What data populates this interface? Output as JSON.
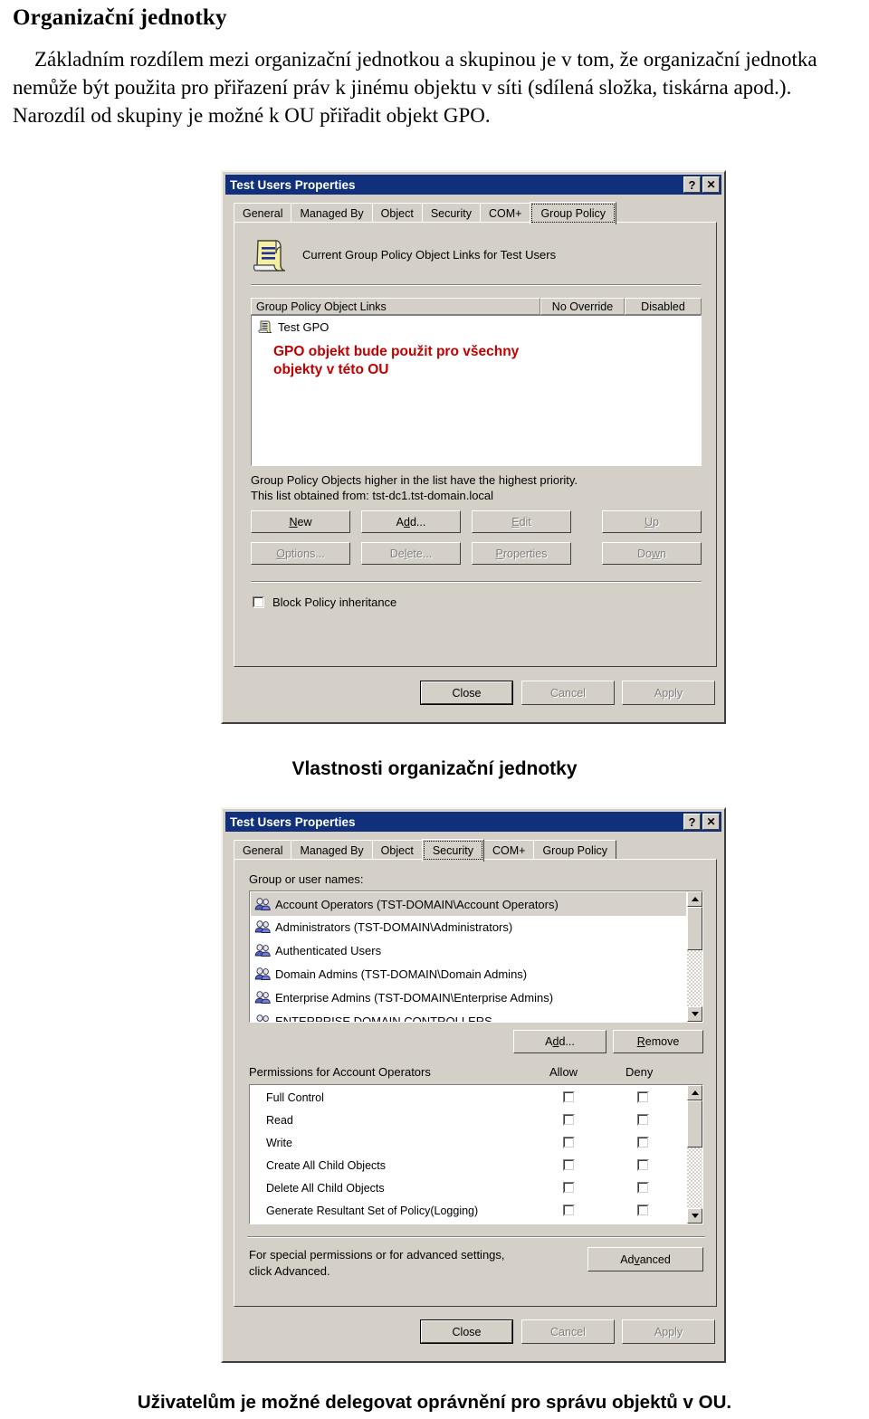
{
  "document": {
    "heading": "Organizační jednotky",
    "paragraph": "Základním rozdílem mezi organizační jednotkou a skupinou je v tom, že organizační jednotka nemůže být použita pro přiřazení práv k jinému objektu v síti (sdílená složka, tiskárna apod.). Narozdíl od skupiny je možné k OU přiřadit objekt GPO.",
    "caption_middle": "Vlastnosti organizační jednotky",
    "caption_bottom": "Uživatelům je možné delegovat oprávnění pro správu objektů v OU."
  },
  "colors": {
    "titlebar": "#10307b",
    "dialog_face": "#d4d0c8",
    "annotation_red": "#c00000"
  },
  "dialog_gpo": {
    "title": "Test Users Properties",
    "help_button": "?",
    "close_button": "✕",
    "tabs": [
      {
        "label": "General",
        "active": false
      },
      {
        "label": "Managed By",
        "active": false
      },
      {
        "label": "Object",
        "active": false
      },
      {
        "label": "Security",
        "active": false
      },
      {
        "label": "COM+",
        "active": false
      },
      {
        "label": "Group Policy",
        "active": true
      }
    ],
    "header_text": "Current Group Policy Object Links for Test Users",
    "list_columns": [
      "Group Policy Object Links",
      "No Override",
      "Disabled"
    ],
    "list_items": [
      {
        "name": "Test GPO"
      }
    ],
    "annotation": "GPO objekt bude použit pro všechny\nobjekty v této OU",
    "info_line1": "Group Policy Objects higher in the list have the highest priority.",
    "info_line2": "This list obtained from: tst-dc1.tst-domain.local",
    "buttons": [
      {
        "label": "New",
        "disabled": false
      },
      {
        "label": "Add...",
        "disabled": false
      },
      {
        "label": "Edit",
        "disabled": true
      },
      {
        "label": "Up",
        "disabled": true
      },
      {
        "label": "Options...",
        "disabled": true
      },
      {
        "label": "Delete...",
        "disabled": true
      },
      {
        "label": "Properties",
        "disabled": true
      },
      {
        "label": "Down",
        "disabled": true
      }
    ],
    "checkbox_label": "Block Policy inheritance",
    "checkbox_checked": false,
    "footer_buttons": [
      {
        "label": "Close",
        "disabled": false,
        "default": true
      },
      {
        "label": "Cancel",
        "disabled": true,
        "default": false
      },
      {
        "label": "Apply",
        "disabled": true,
        "default": false
      }
    ]
  },
  "dialog_security": {
    "title": "Test Users Properties",
    "help_button": "?",
    "close_button": "✕",
    "tabs": [
      {
        "label": "General",
        "active": false
      },
      {
        "label": "Managed By",
        "active": false
      },
      {
        "label": "Object",
        "active": false
      },
      {
        "label": "Security",
        "active": true
      },
      {
        "label": "COM+",
        "active": false
      },
      {
        "label": "Group Policy",
        "active": false
      }
    ],
    "group_label": "Group or user names:",
    "group_items": [
      {
        "name": "Account Operators (TST-DOMAIN\\Account Operators)",
        "selected": true
      },
      {
        "name": "Administrators (TST-DOMAIN\\Administrators)",
        "selected": false
      },
      {
        "name": "Authenticated Users",
        "selected": false
      },
      {
        "name": "Domain Admins (TST-DOMAIN\\Domain Admins)",
        "selected": false
      },
      {
        "name": "Enterprise Admins (TST-DOMAIN\\Enterprise Admins)",
        "selected": false
      },
      {
        "name": "ENTERPRISE DOMAIN CONTROLLERS",
        "selected": false
      }
    ],
    "add_button": "Add...",
    "remove_button": "Remove",
    "permissions_label": "Permissions for Account Operators",
    "allow_header": "Allow",
    "deny_header": "Deny",
    "permissions": [
      {
        "name": "Full Control",
        "allow": false,
        "deny": false
      },
      {
        "name": "Read",
        "allow": false,
        "deny": false
      },
      {
        "name": "Write",
        "allow": false,
        "deny": false
      },
      {
        "name": "Create All Child Objects",
        "allow": false,
        "deny": false
      },
      {
        "name": "Delete All Child Objects",
        "allow": false,
        "deny": false
      },
      {
        "name": "Generate Resultant Set of Policy(Logging)",
        "allow": false,
        "deny": false
      }
    ],
    "advanced_text_line1": "For special permissions or for advanced settings,",
    "advanced_text_line2": "click Advanced.",
    "advanced_button": "Advanced",
    "footer_buttons": [
      {
        "label": "Close",
        "disabled": false,
        "default": true
      },
      {
        "label": "Cancel",
        "disabled": true,
        "default": false
      },
      {
        "label": "Apply",
        "disabled": true,
        "default": false
      }
    ]
  }
}
